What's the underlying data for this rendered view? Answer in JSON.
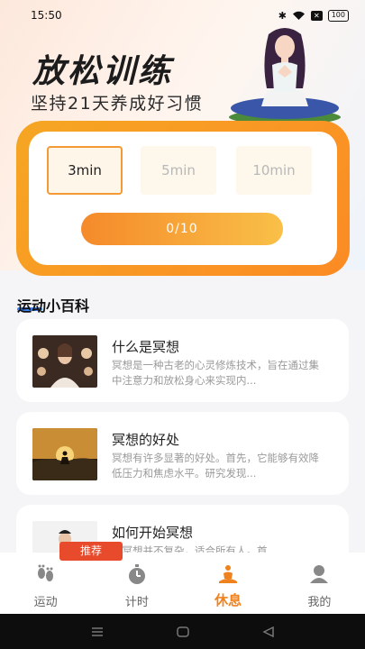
{
  "status_bar": {
    "time": "15:50",
    "battery": "100"
  },
  "hero": {
    "title": "放松训练",
    "subtitle": "坚持21天养成好习惯"
  },
  "timer": {
    "durations": [
      "3min",
      "5min",
      "10min"
    ],
    "selected": "3min",
    "progress": "0/10"
  },
  "section": {
    "title": "运动小百科"
  },
  "articles": [
    {
      "title": "什么是冥想",
      "desc": "冥想是一种古老的心灵修炼技术，旨在通过集中注意力和放松身心来实现内..."
    },
    {
      "title": "冥想的好处",
      "desc": "冥想有许多显著的好处。首先，它能够有效降低压力和焦虑水平。研究发现..."
    },
    {
      "title": "如何开始冥想",
      "desc": "始冥想并不复杂，适合所有人。首"
    }
  ],
  "badge": "推荐",
  "tabs": [
    {
      "label": "运动",
      "icon": "footprints-icon"
    },
    {
      "label": "计时",
      "icon": "stopwatch-icon"
    },
    {
      "label": "休息",
      "icon": "meditation-icon"
    },
    {
      "label": "我的",
      "icon": "profile-icon"
    }
  ],
  "active_tab": "休息",
  "colors": {
    "accent": "#f0821e",
    "card_gradient": "#f6a623",
    "badge": "#e84a2c"
  }
}
